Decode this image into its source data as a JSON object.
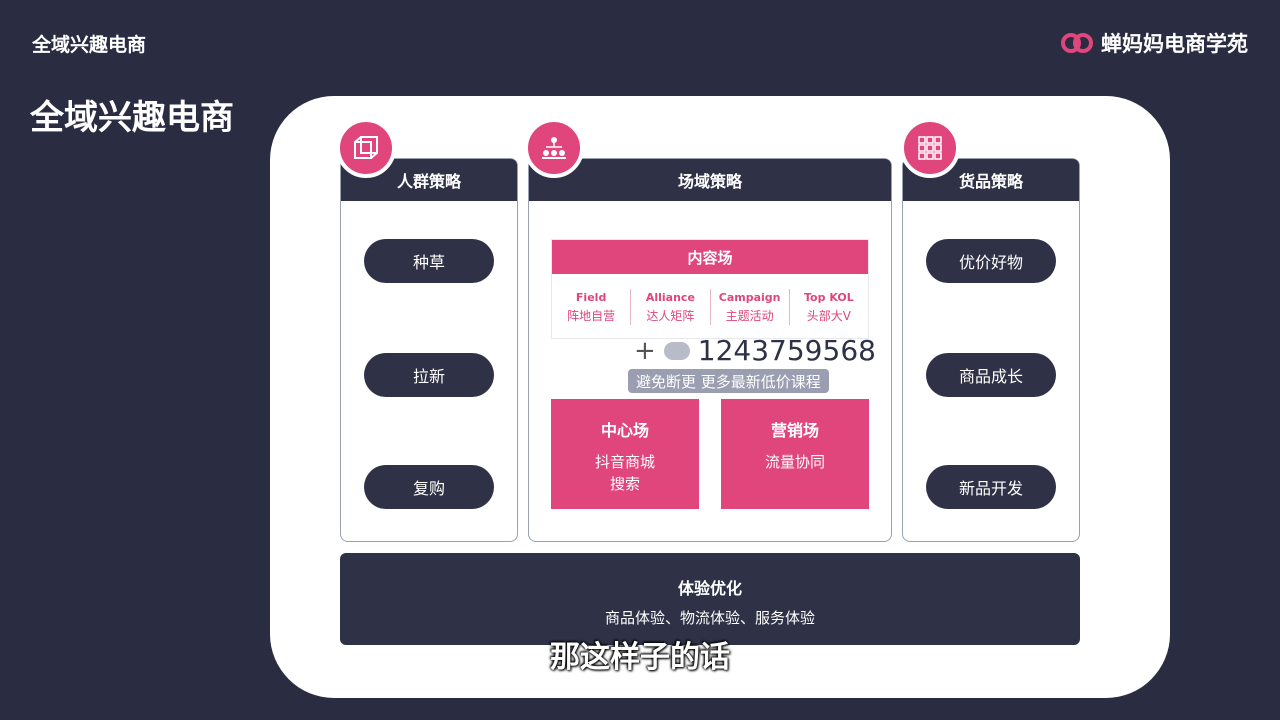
{
  "header": {
    "title": "全域兴趣电商",
    "brand": "蝉妈妈电商学苑"
  },
  "page_title": "全域兴趣电商",
  "columns": {
    "audience": {
      "title": "人群策略",
      "items": [
        "种草",
        "拉新",
        "复购"
      ]
    },
    "field": {
      "title": "场域策略",
      "content": {
        "title": "内容场",
        "cells": [
          {
            "en": "Field",
            "zh": "阵地自营"
          },
          {
            "en": "Alliance",
            "zh": "达人矩阵"
          },
          {
            "en": "Campaign",
            "zh": "主题活动"
          },
          {
            "en": "Top KOL",
            "zh": "头部大V"
          }
        ]
      },
      "center": {
        "title": "中心场",
        "line1": "抖音商城",
        "line2": "搜索"
      },
      "marketing": {
        "title": "营销场",
        "line1": "流量协同"
      }
    },
    "goods": {
      "title": "货品策略",
      "items": [
        "优价好物",
        "商品成长",
        "新品开发"
      ]
    }
  },
  "bottom": {
    "title": "体验优化",
    "subtitle": "商品体验、物流体验、服务体验"
  },
  "overlay": {
    "qq": "1243759568",
    "notice": "避免断更 更多最新低价课程"
  },
  "caption": "那这样子的话",
  "colors": {
    "accent": "#e0457b",
    "dark": "#2f3247",
    "bg": "#2a2d42"
  }
}
